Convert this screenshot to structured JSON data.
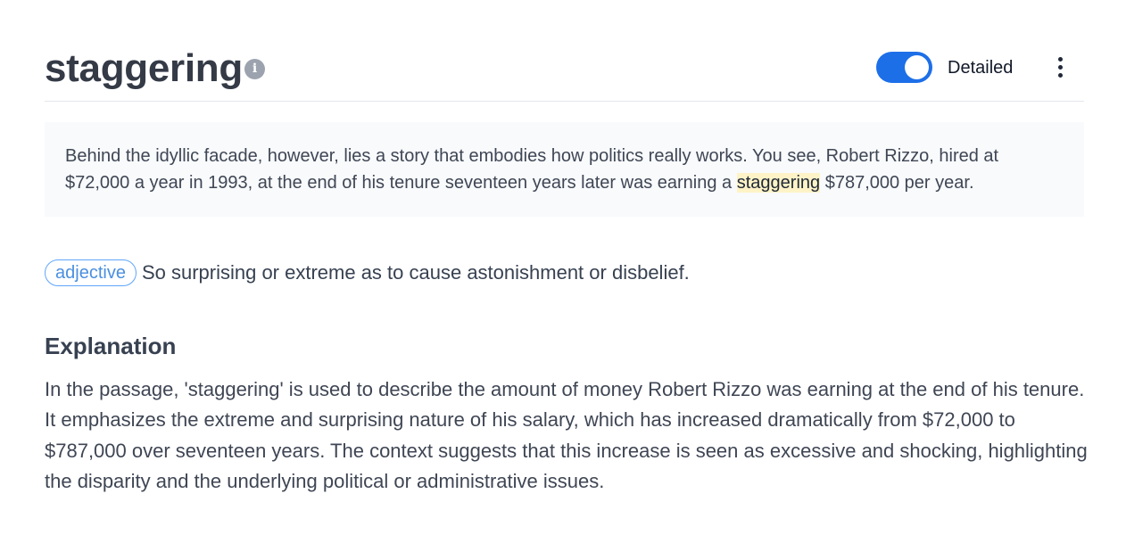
{
  "header": {
    "word": "staggering",
    "info_icon": "info-icon",
    "toggle_label": "Detailed",
    "toggle_on": true,
    "more_icon": "more-vertical-icon"
  },
  "passage": {
    "before": "Behind the idyllic facade, however, lies a story that embodies how politics really works. You see, Robert Rizzo, hired at $72,000 a year in 1993, at the end of his tenure seventeen years later was earning a ",
    "highlight": "staggering",
    "after": " $787,000 per year."
  },
  "definition": {
    "part_of_speech": "adjective",
    "text": "So surprising or extreme as to cause astonishment or disbelief."
  },
  "explanation": {
    "heading": "Explanation",
    "text": "In the passage, 'staggering' is used to describe the amount of money Robert Rizzo was earning at the end of his tenure. It emphasizes the extreme and surprising nature of his salary, which has increased dramatically from $72,000 to $787,000 over seventeen years. The context suggests that this increase is seen as excessive and shocking, highlighting the disparity and the underlying political or administrative issues."
  },
  "colors": {
    "toggle_accent": "#1d6fe8",
    "highlight": "#fef3c7",
    "badge_border": "#60a5fa"
  }
}
